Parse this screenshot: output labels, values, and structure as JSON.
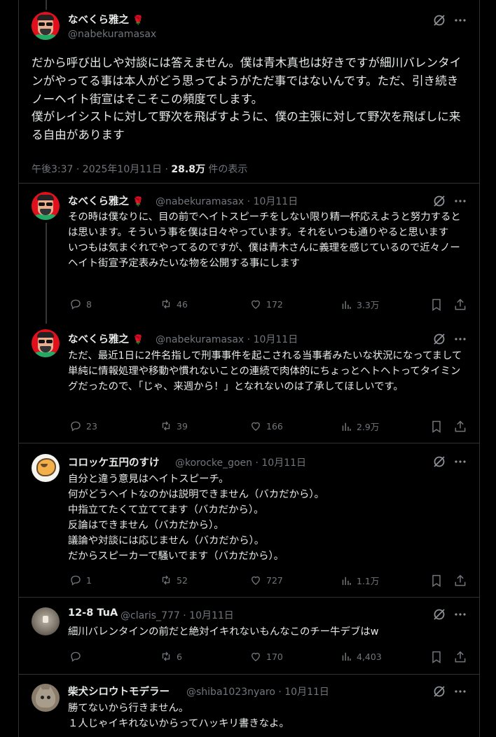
{
  "main_tweet": {
    "name": "なべくら雅之",
    "handle": "@nabekuramasax",
    "text": "だから呼び出しや対談には答えません。僕は青木真也は好きですが細川バレンタインがやってる事は本人がどう思ってようがただ事ではないんです。ただ、引き続きノーヘイト街宣はそこそこの頻度でします。\n僕がレイシストに対して野次を飛ばすように、僕の主張に対して野次を飛ばしに来る自由があります",
    "timestamp": "午後3:37 · 2025年10月11日 · ",
    "views": "28.8万",
    "views_suffix": " 件の表示"
  },
  "replies": [
    {
      "name": "なべくら雅之",
      "handle": "@nabekuramasax · 10月11日",
      "text": "その時は僕なりに、目の前でヘイトスピーチをしない限り精一杯応えようと努力するとは思います。そういう事を僕は日々やっています。それをいつも通りやると思います\nいつもは気まぐれでやってるのですが、僕は青木さんに義理を感じているので近々ノーヘイト街宣予定表みたいな物を公開する事にします",
      "replies": "8",
      "retweets": "46",
      "likes": "172",
      "views": "3.3万"
    },
    {
      "name": "なべくら雅之",
      "handle": "@nabekuramasax · 10月11日",
      "text": "ただ、最近1日に2件名指しで刑事事件を起こされる当事者みたいな状況になってまして単純に情報処理や移動や慣れないことの連続で肉体的にちょっとヘトヘトってタイミングだったので、「じゃ、来週から！」となれないのは了承してほしいです。",
      "replies": "23",
      "retweets": "39",
      "likes": "166",
      "views": "2.9万"
    },
    {
      "name": "コロッケ五円のすけ",
      "handle": "@korocke_goen · 10月11日",
      "text": "自分と違う意見はヘイトスピーチ。\n何がどうヘイトなのかは説明できません（バカだから）。\n中指立てたくて立ててます（バカだから）。\n反論はできません（バカだから）。\n議論や対談には応じません（バカだから）。\nだからスピーカーで騒いでます（バカだから）。",
      "replies": "1",
      "retweets": "52",
      "likes": "727",
      "views": "1.1万"
    },
    {
      "name": "12-8 TuA",
      "handle": "@claris_777 · 10月11日",
      "text": "細川バレンタインの前だと絶対イキれないもんなこのチー牛デブはw",
      "replies": "",
      "retweets": "6",
      "likes": "170",
      "views": "4,403"
    },
    {
      "name": "柴犬シロウトモデラー",
      "handle": "@shiba1023nyaro · 10月11日",
      "text": "勝てないから行きません。\n１人じゃイキれないからってハッキリ書きなよ。"
    }
  ],
  "colors": {
    "background": "#000000",
    "text": "#e7e9ea",
    "muted": "#71767b",
    "border": "#2f3336",
    "rose": "#e0245e"
  }
}
